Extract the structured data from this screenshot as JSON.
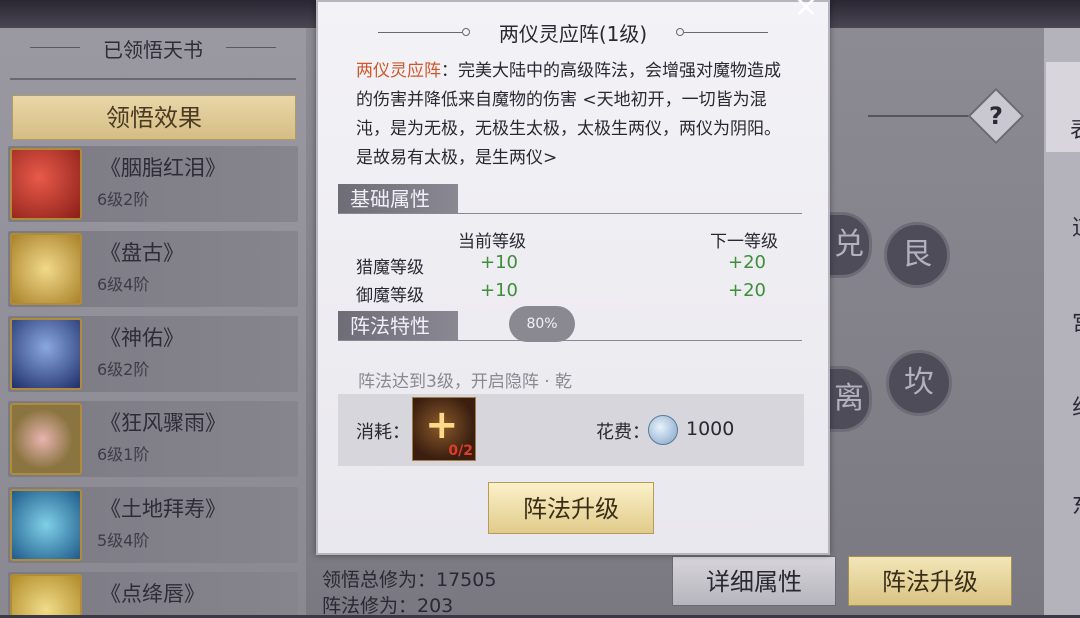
{
  "left_panel": {
    "title": "已领悟天书",
    "tab_label": "领悟效果",
    "books": [
      {
        "name": "《胭脂红泪》",
        "level": "6级2阶",
        "icon": "red-scroll-icon",
        "color": "#c0362c"
      },
      {
        "name": "《盘古》",
        "level": "6级4阶",
        "icon": "gold-scroll-icon",
        "color": "#c9a13a"
      },
      {
        "name": "《神佑》",
        "level": "6级2阶",
        "icon": "blue-book-icon",
        "color": "#2e4e9a"
      },
      {
        "name": "《狂风骤雨》",
        "level": "6级1阶",
        "icon": "flower-book-icon",
        "color": "#a58a4a"
      },
      {
        "name": "《土地拜寿》",
        "level": "5级4阶",
        "icon": "teal-scroll-icon",
        "color": "#2f8fb0"
      },
      {
        "name": "《点绛唇》",
        "level": "",
        "icon": "yellow-scroll-icon",
        "color": "#d8b44a"
      }
    ]
  },
  "bottom": {
    "total_cultivation": "领悟总修为：17505",
    "formation_cultivation": "阵法修为：203",
    "detail_button": "详细属性",
    "upgrade_button": "阵法升级"
  },
  "background_glyphs": [
    "艮",
    "兑",
    "坎",
    "离"
  ],
  "side_chars": [
    "表",
    "道",
    "宫",
    "组",
    "东"
  ],
  "modal": {
    "title": "两仪灵应阵(1级)",
    "desc_highlight": "两仪灵应阵",
    "desc_text": "：完美大陆中的高级阵法，会增强对魔物造成的伤害并降低来自魔物的伤害 <天地初开，一切皆为混沌，是为无极，无极生太极，太极生两仪，两仪为阴阳。是故易有太极，是生两仪>",
    "section_basic": "基础属性",
    "current_level_header": "当前等级",
    "next_level_header": "下一等级",
    "attributes": [
      {
        "label": "猎魔等级",
        "current": "+10",
        "next": "+20"
      },
      {
        "label": "御魔等级",
        "current": "+10",
        "next": "+20"
      }
    ],
    "section_feature": "阵法特性",
    "progress_badge": "80%",
    "feature_text": "阵法达到3级，开启隐阵 · 乾",
    "cost_label": "消耗：",
    "cost_item_qty": "0/2",
    "fee_label": "花费：",
    "fee_amount": "1000",
    "upgrade_button": "阵法升级",
    "close_symbol": "✕"
  },
  "colors": {
    "highlight": "#d0572a",
    "attr_value": "#3e8e3a",
    "button_gold": "#e1cb8b"
  }
}
